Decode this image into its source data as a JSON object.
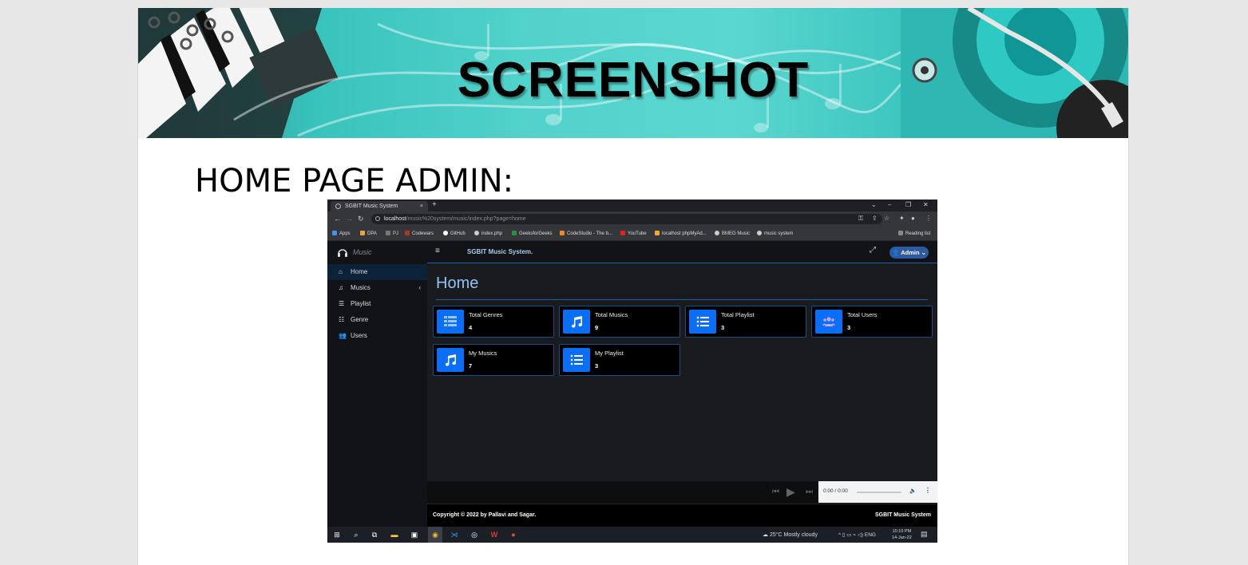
{
  "slide": {
    "banner_title": "SCREENSHOT",
    "heading": "HOME PAGE ADMIN:"
  },
  "browser": {
    "tab_title": "SGBIT Music System",
    "tab_close": "×",
    "new_tab": "+",
    "window_controls": [
      "⌄",
      "–",
      "❐",
      "✕"
    ],
    "url_host": "localhost",
    "url_path": "/music%20system/music/index.php?page=home",
    "bookmarks": [
      "Apps",
      "DPA",
      "PJ",
      "Codewars",
      "GitHub",
      "index.php",
      "GeeksforGeeks",
      "CodeStudio - The b...",
      "YouTube",
      "localhost phpMyAd...",
      "BMEG Music",
      "music system"
    ],
    "reading_list": "Reading list"
  },
  "app": {
    "brand": "Music",
    "title": "SGBIT Music System.",
    "admin_label": "Admin",
    "sidebar": [
      {
        "label": "Home",
        "icon": "home-icon",
        "active": true
      },
      {
        "label": "Musics",
        "icon": "music-note-icon",
        "has_chevron": true
      },
      {
        "label": "Playlist",
        "icon": "list-icon"
      },
      {
        "label": "Genre",
        "icon": "list-bullets-icon"
      },
      {
        "label": "Users",
        "icon": "users-icon"
      }
    ],
    "page_heading": "Home",
    "cards": [
      {
        "title": "Total Genres",
        "value": "4",
        "icon": "list-bullets-icon"
      },
      {
        "title": "Total Musics",
        "value": "9",
        "icon": "music-note-icon"
      },
      {
        "title": "Total Playlist",
        "value": "3",
        "icon": "list-icon"
      },
      {
        "title": "Total Users",
        "value": "3",
        "icon": "users-icon"
      },
      {
        "title": "My Musics",
        "value": "7",
        "icon": "music-note-icon"
      },
      {
        "title": "My Playlist",
        "value": "3",
        "icon": "list-icon"
      }
    ],
    "player_time": "0:00 / 0:00",
    "footer_copyright": "Copyright © 2022 by Pallavi and Sagar.",
    "footer_system": "SGBIT Music System"
  },
  "taskbar": {
    "weather": "25°C  Mostly cloudy",
    "lang": "ENG",
    "time": "10:10 PM",
    "date": "14-Jan-22"
  },
  "colors": {
    "accent": "#0b6ef6",
    "banner": "#52d2cb",
    "heading_blue": "#8ec3f6"
  }
}
